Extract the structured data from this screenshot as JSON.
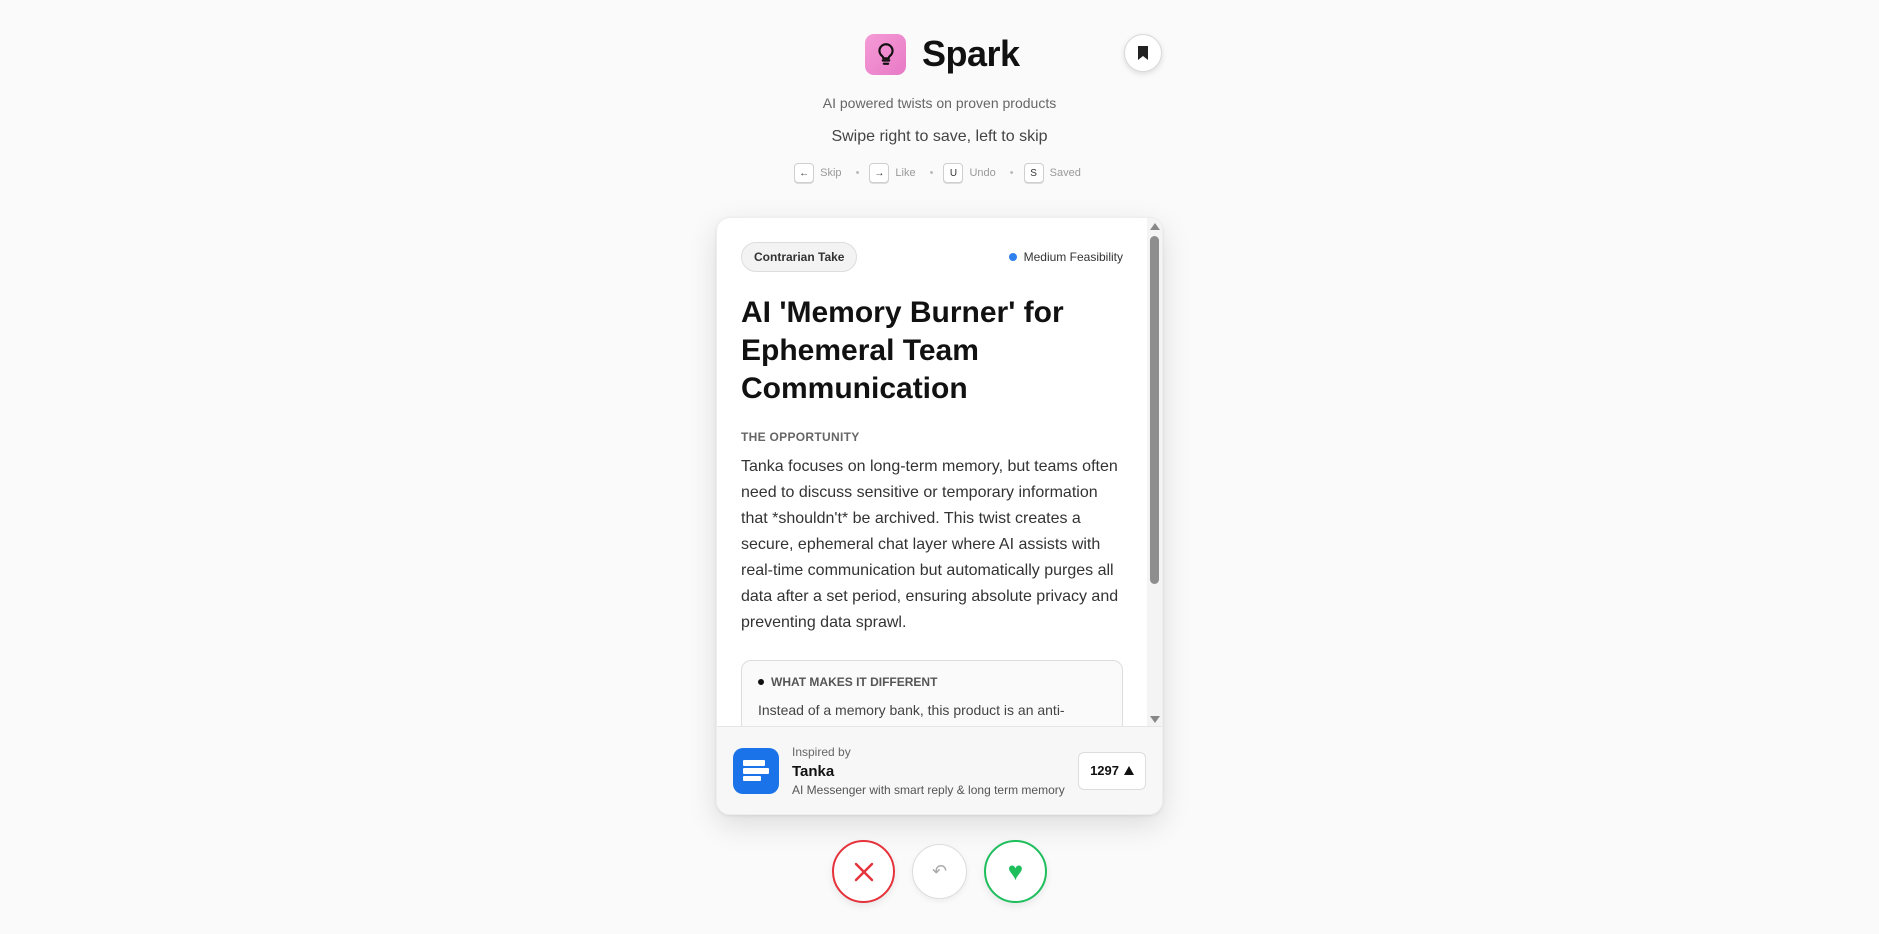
{
  "app": {
    "name": "Spark",
    "tagline": "AI powered twists on proven products",
    "instructions": "Swipe right to save, left to skip",
    "icons": {
      "logo": "lightbulb-icon",
      "saved": "bookmark-icon"
    }
  },
  "shortcuts": [
    {
      "key": "←",
      "label": "Skip"
    },
    {
      "key": "→",
      "label": "Like"
    },
    {
      "key": "U",
      "label": "Undo"
    },
    {
      "key": "S",
      "label": "Saved"
    }
  ],
  "card": {
    "tag": "Contrarian Take",
    "feasibility": "Medium Feasibility",
    "feasibility_color": "#2f80ed",
    "title": "AI 'Memory Burner' for Ephemeral Team Communication",
    "opportunity_label": "THE OPPORTUNITY",
    "opportunity_text": "Tanka focuses on long-term memory, but teams often need to discuss sensitive or temporary information that *shouldn't* be archived. This twist creates a secure, ephemeral chat layer where AI assists with real-time communication but automatically purges all data after a set period, ensuring absolute privacy and preventing data sprawl.",
    "difference_label": "WHAT MAKES IT DIFFERENT",
    "difference_text": "Instead of a memory bank, this product is an anti-memory bank, prioritizing data deletion and privacy over"
  },
  "footer": {
    "inspired_label": "Inspired by",
    "product_name": "Tanka",
    "product_desc": "AI Messenger with smart reply & long term memory",
    "votes": "1297",
    "product_icon": "chat-bubbles-icon"
  },
  "actions": {
    "skip_icon": "close-icon",
    "undo_glyph": "↶",
    "like_glyph": "♥"
  },
  "colors": {
    "skip": "#e5323b",
    "like": "#1ebe5d",
    "brand_gradient_start": "#f59bd6",
    "brand_gradient_end": "#e879c6",
    "product_icon_bg": "#1a73e8"
  }
}
